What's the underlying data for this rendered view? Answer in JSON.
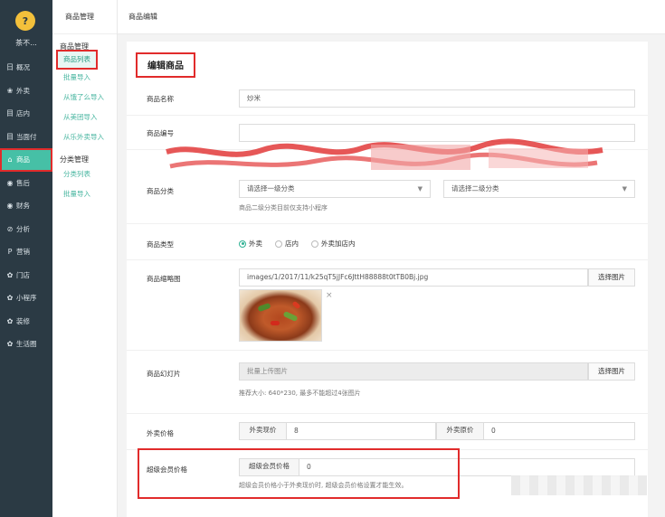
{
  "sidebar": {
    "logo_glyph": "?",
    "user": "茶不...",
    "items": [
      {
        "icon": "日",
        "label": "概况"
      },
      {
        "icon": "❀",
        "label": "外卖"
      },
      {
        "icon": "目",
        "label": "店内"
      },
      {
        "icon": "目",
        "label": "当面付"
      },
      {
        "icon": "⌂",
        "label": "商品"
      },
      {
        "icon": "◉",
        "label": "售后"
      },
      {
        "icon": "◉",
        "label": "财务"
      },
      {
        "icon": "⊘",
        "label": "分析"
      },
      {
        "icon": "P",
        "label": "营销"
      },
      {
        "icon": "✿",
        "label": "门店"
      },
      {
        "icon": "✿",
        "label": "小程序"
      },
      {
        "icon": "✿",
        "label": "装修"
      },
      {
        "icon": "✿",
        "label": "生活圈"
      }
    ]
  },
  "subnav": {
    "header": "商品管理",
    "group1": "商品管理",
    "current": "商品列表",
    "items1": [
      "批量导入",
      "从饿了么导入",
      "从美团导入",
      "从乐外卖导入"
    ],
    "group2": "分类管理",
    "items2": [
      "分类列表",
      "批量导入"
    ]
  },
  "topbar": {
    "breadcrumb": "商品编辑"
  },
  "form": {
    "title": "编辑商品",
    "name_label": "商品名称",
    "name_value": "炒米",
    "code_label": "商品编号",
    "code_value": "",
    "category_label": "商品分类",
    "category1_placeholder": "请选择一级分类",
    "category2_placeholder": "请选择二级分类",
    "category_hint": "商品二级分类目前仅支持小程序",
    "type_label": "商品类型",
    "type_options": [
      "外卖",
      "店内",
      "外卖加店内"
    ],
    "thumb_label": "商品缩略图",
    "thumb_path": "images/1/2017/11/k25qT5jJFc6JttH88888t0tTB0Bj.jpg",
    "select_image": "选择图片",
    "slides_label": "商品幻灯片",
    "slides_placeholder": "批量上传图片",
    "slides_hint": "推荐大小: 640*230, 最多不能超过4张图片",
    "price_label": "外卖价格",
    "price_current_label": "外卖现价",
    "price_current_value": "8",
    "price_original_label": "外卖原价",
    "price_original_value": "0",
    "vip_label": "超级会员价格",
    "vip_price_label": "超级会员价格",
    "vip_price_value": "0",
    "vip_hint": "超级会员价格小于外卖现价时, 超级会员价格设置才能生效。"
  },
  "colors": {
    "accent": "#46c0a6",
    "highlight": "#e12b2b",
    "sidebar_bg": "#2b3a44"
  }
}
